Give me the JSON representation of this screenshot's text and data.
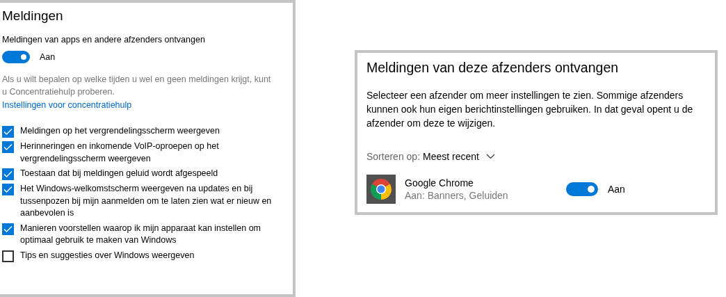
{
  "notifications": {
    "title": "Meldingen",
    "main_toggle": {
      "label": "Meldingen van apps en andere afzenders ontvangen",
      "on": true,
      "state_text": "Aan"
    },
    "hint": "Als u wilt bepalen op welke tijden u wel en geen meldingen krijgt, kunt u Concentratiehulp proberen.",
    "link": "Instellingen voor concentratiehulp",
    "options": [
      {
        "label": "Meldingen op het vergrendelingsscherm weergeven",
        "checked": true
      },
      {
        "label": "Herinneringen en inkomende VoIP-oproepen op het vergrendelingsscherm weergeven",
        "checked": true
      },
      {
        "label": "Toestaan dat bij meldingen geluid wordt afgespeeld",
        "checked": true
      },
      {
        "label": "Het Windows-welkomstscherm weergeven na updates en bij tussenpozen bij mijn aanmelden om te laten zien wat er nieuw en aanbevolen is",
        "checked": true
      },
      {
        "label": "Manieren voorstellen waarop ik mijn apparaat kan instellen om optimaal gebruik te maken van Windows",
        "checked": true
      },
      {
        "label": "Tips en suggesties over Windows weergeven",
        "checked": false
      }
    ]
  },
  "senders": {
    "title": "Meldingen van deze afzenders ontvangen",
    "description": "Selecteer een afzender om meer instellingen te zien. Sommige afzenders kunnen ook hun eigen berichtinstellingen gebruiken. In dat geval opent u de afzender om deze te wijzigen.",
    "sort_label": "Sorteren op:",
    "sort_value": "Meest recent",
    "apps": [
      {
        "name": "Google Chrome",
        "detail": "Aan: Banners, Geluiden",
        "on": true,
        "state_text": "Aan"
      }
    ]
  }
}
